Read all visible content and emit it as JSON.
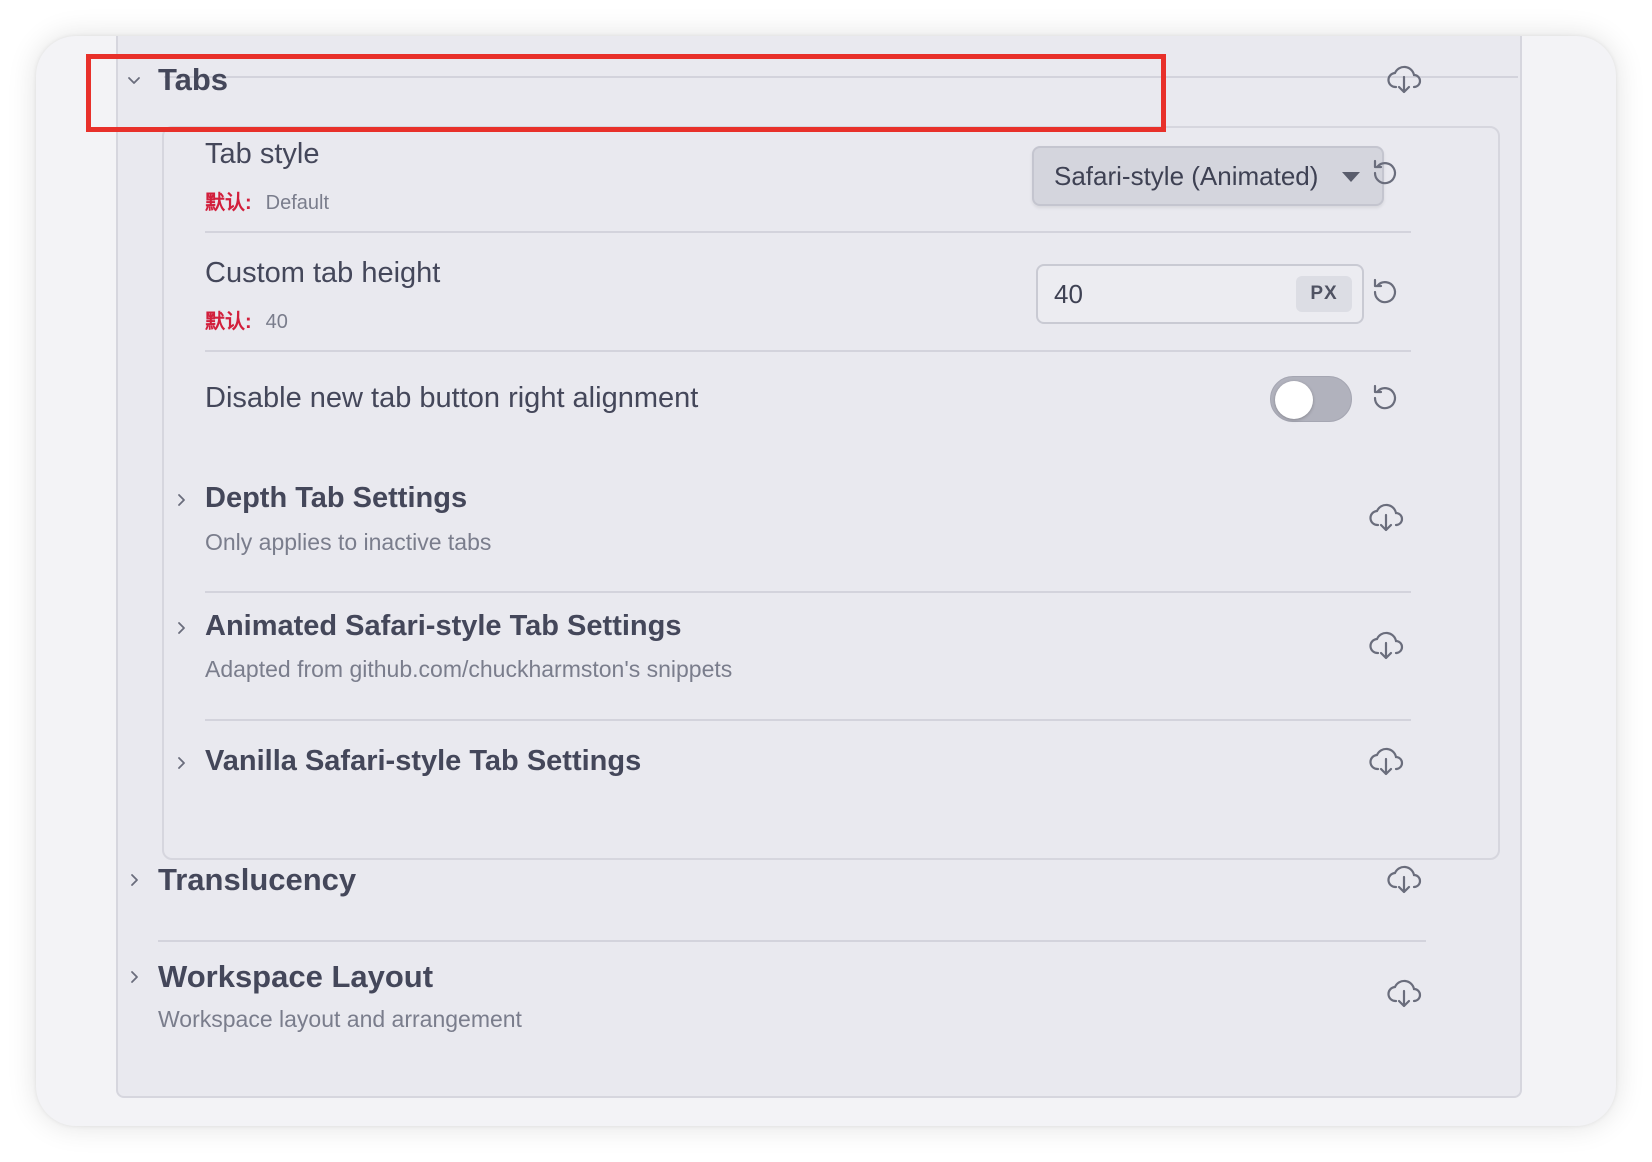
{
  "sections": {
    "tabs": {
      "title": "Tabs",
      "expanded": true,
      "settings": {
        "tab_style": {
          "name": "Tab style",
          "default_label": "默认:",
          "default_value": "Default",
          "selected": "Safari-style (Animated)"
        },
        "custom_tab_height": {
          "name": "Custom tab height",
          "default_label": "默认:",
          "default_value": "40",
          "value": "40",
          "unit": "PX"
        },
        "disable_new_tab_alignment": {
          "name": "Disable new tab button right alignment",
          "enabled": false
        }
      },
      "subsections": [
        {
          "title": "Depth Tab Settings",
          "subtitle": "Only applies to inactive tabs"
        },
        {
          "title": "Animated Safari-style Tab Settings",
          "subtitle": "Adapted from github.com/chuckharmston's snippets"
        },
        {
          "title": "Vanilla Safari-style Tab Settings",
          "subtitle": ""
        }
      ]
    },
    "translucency": {
      "title": "Translucency"
    },
    "workspace_layout": {
      "title": "Workspace Layout",
      "subtitle": "Workspace layout and arrangement"
    }
  },
  "icons": {
    "download": "cloud-download-icon",
    "reset": "reset-icon",
    "chevron_down": "chevron-down-icon",
    "chevron_right": "chevron-right-icon"
  },
  "colors": {
    "highlight": "#e8302a",
    "default_label": "#d21f3c"
  }
}
